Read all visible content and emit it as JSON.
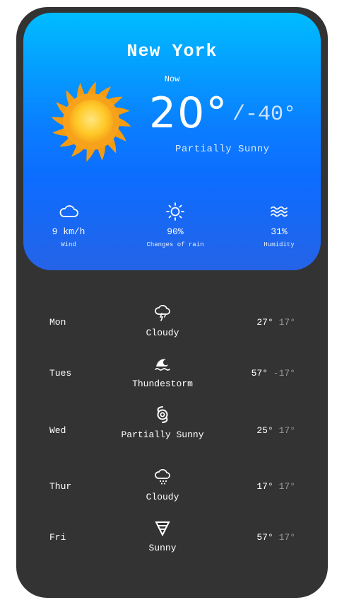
{
  "current": {
    "city": "New York",
    "time_label": "Now",
    "temp": "20°",
    "low": "/-40°",
    "condition": "Partially Sunny",
    "icon": "sun-icon",
    "colors": {
      "gradient_top": "#00bcff",
      "gradient_bottom": "#2563e6",
      "background": "#333333"
    }
  },
  "stats": [
    {
      "icon": "cloud-icon",
      "value": "9 km/h",
      "label": "Wind"
    },
    {
      "icon": "sun-outline-icon",
      "value": "90%",
      "label": "Changes of rain"
    },
    {
      "icon": "waves-icon",
      "value": "31%",
      "label": "Humidity"
    }
  ],
  "forecast": [
    {
      "day": "Mon",
      "icon": "thunder-cloud-icon",
      "condition": "Cloudy",
      "high": "27°",
      "low": "17°"
    },
    {
      "day": "Tues",
      "icon": "wave-icon",
      "condition": "Thundestorm",
      "high": "57°",
      "low": "-17°"
    },
    {
      "day": "Wed",
      "icon": "hurricane-icon",
      "condition": "Partially Sunny",
      "high": "25°",
      "low": "17°"
    },
    {
      "day": "Thur",
      "icon": "hail-cloud-icon",
      "condition": "Cloudy",
      "high": "17°",
      "low": "17°"
    },
    {
      "day": "Fri",
      "icon": "tornado-icon",
      "condition": "Sunny",
      "high": "57°",
      "low": "17°"
    }
  ]
}
